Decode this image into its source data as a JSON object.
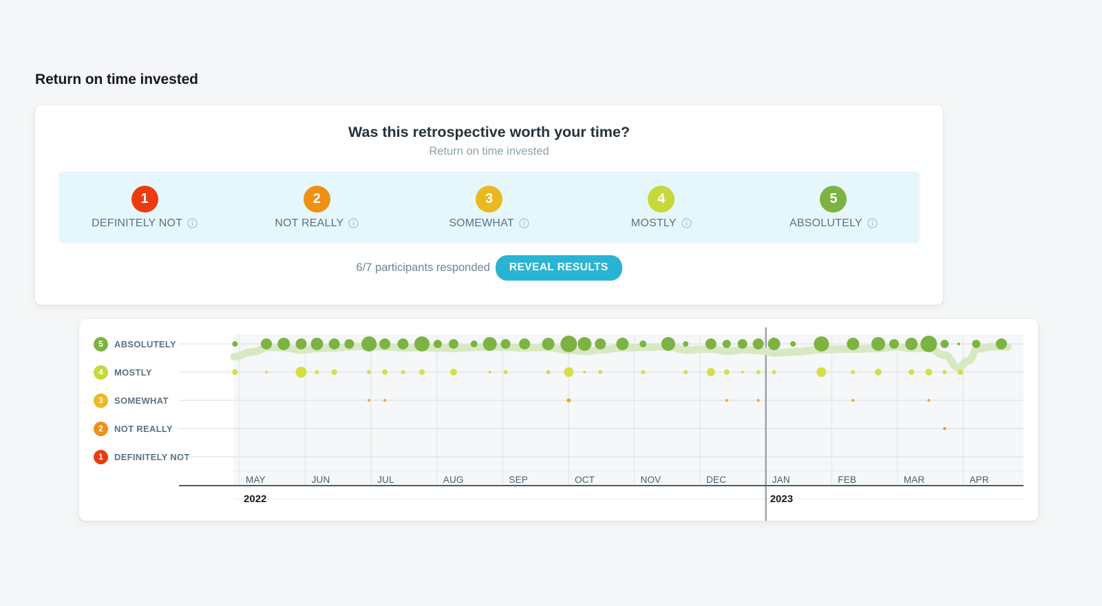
{
  "page": {
    "title": "Return on time invested"
  },
  "poll": {
    "question": "Was this retrospective worth your time?",
    "subtitle": "Return on time invested",
    "participants": "6/7 participants responded",
    "reveal_label": "REVEAL RESULTS",
    "reveal_color": "#2ab4d3",
    "strip_background": "#e5f7fb",
    "options": [
      {
        "value": "1",
        "label": "DEFINITELY NOT",
        "color": "#ed3b11",
        "info_icon": "info-icon"
      },
      {
        "value": "2",
        "label": "NOT REALLY",
        "color": "#ef9014",
        "info_icon": "info-icon"
      },
      {
        "value": "3",
        "label": "SOMEWHAT",
        "color": "#ecb81f",
        "info_icon": "info-icon"
      },
      {
        "value": "4",
        "label": "MOSTLY",
        "color": "#c6d83a",
        "info_icon": "info-icon"
      },
      {
        "value": "5",
        "label": "ABSOLUTELY",
        "color": "#7cb342",
        "info_icon": "info-icon"
      }
    ]
  },
  "chart_data": {
    "type": "scatter",
    "title": "Return on time invested",
    "xlabel": "",
    "ylabel": "",
    "grid": true,
    "legend_position": "left",
    "ylim": [
      1,
      5
    ],
    "y_categories": [
      {
        "value": "5",
        "label": "ABSOLUTELY",
        "color": "#7cb342"
      },
      {
        "value": "4",
        "label": "MOSTLY",
        "color": "#c6d83a"
      },
      {
        "value": "3",
        "label": "SOMEWHAT",
        "color": "#ecb81f"
      },
      {
        "value": "2",
        "label": "NOT REALLY",
        "color": "#ef9014"
      },
      {
        "value": "1",
        "label": "DEFINITELY NOT",
        "color": "#ed3b11"
      }
    ],
    "x_ticks": [
      "MAY",
      "JUN",
      "JUL",
      "AUG",
      "SEP",
      "OCT",
      "NOV",
      "DEC",
      "JAN",
      "FEB",
      "MAR",
      "APR"
    ],
    "year_markers": [
      {
        "label": "2022",
        "tick_index": 0
      },
      {
        "label": "2023",
        "tick_index": 8
      }
    ],
    "year_divider_at_tick": 8,
    "series": [
      {
        "name": "ABSOLUTELY",
        "y": 5,
        "color": "#7cb342",
        "points": [
          {
            "x": 0.06,
            "r": 4
          },
          {
            "x": 2.05,
            "r": 8
          },
          {
            "x": 3.15,
            "r": 9
          },
          {
            "x": 4.25,
            "r": 8
          },
          {
            "x": 5.25,
            "r": 9
          },
          {
            "x": 6.35,
            "r": 8
          },
          {
            "x": 7.3,
            "r": 7
          },
          {
            "x": 8.55,
            "r": 11
          },
          {
            "x": 9.55,
            "r": 8
          },
          {
            "x": 10.7,
            "r": 8
          },
          {
            "x": 11.9,
            "r": 11
          },
          {
            "x": 12.9,
            "r": 6
          },
          {
            "x": 13.9,
            "r": 7
          },
          {
            "x": 15.2,
            "r": 5
          },
          {
            "x": 16.2,
            "r": 10
          },
          {
            "x": 17.2,
            "r": 7
          },
          {
            "x": 18.4,
            "r": 8
          },
          {
            "x": 19.9,
            "r": 9
          },
          {
            "x": 21.2,
            "r": 12
          },
          {
            "x": 22.2,
            "r": 10
          },
          {
            "x": 23.2,
            "r": 8
          },
          {
            "x": 24.6,
            "r": 9
          },
          {
            "x": 25.9,
            "r": 5
          },
          {
            "x": 27.5,
            "r": 10
          },
          {
            "x": 28.6,
            "r": 4
          },
          {
            "x": 30.2,
            "r": 8
          },
          {
            "x": 31.2,
            "r": 6
          },
          {
            "x": 32.2,
            "r": 7
          },
          {
            "x": 33.2,
            "r": 8
          },
          {
            "x": 34.2,
            "r": 9
          },
          {
            "x": 35.4,
            "r": 4
          },
          {
            "x": 37.2,
            "r": 11
          },
          {
            "x": 39.2,
            "r": 9
          },
          {
            "x": 40.8,
            "r": 10
          },
          {
            "x": 41.8,
            "r": 7
          },
          {
            "x": 42.9,
            "r": 9
          },
          {
            "x": 44.0,
            "r": 12
          },
          {
            "x": 45.0,
            "r": 6
          },
          {
            "x": 45.9,
            "r": 2
          },
          {
            "x": 47.0,
            "r": 6
          },
          {
            "x": 48.6,
            "r": 8
          }
        ]
      },
      {
        "name": "MOSTLY",
        "y": 4,
        "color": "#d4df48",
        "points": [
          {
            "x": 0.06,
            "r": 4
          },
          {
            "x": 2.05,
            "r": 2
          },
          {
            "x": 4.25,
            "r": 8
          },
          {
            "x": 5.25,
            "r": 3
          },
          {
            "x": 6.35,
            "r": 4
          },
          {
            "x": 8.55,
            "r": 3
          },
          {
            "x": 9.55,
            "r": 4
          },
          {
            "x": 10.7,
            "r": 3
          },
          {
            "x": 11.9,
            "r": 4
          },
          {
            "x": 13.9,
            "r": 5
          },
          {
            "x": 16.2,
            "r": 2
          },
          {
            "x": 17.2,
            "r": 3
          },
          {
            "x": 19.9,
            "r": 3
          },
          {
            "x": 21.2,
            "r": 7
          },
          {
            "x": 22.2,
            "r": 2
          },
          {
            "x": 23.2,
            "r": 3
          },
          {
            "x": 25.9,
            "r": 3
          },
          {
            "x": 28.6,
            "r": 3
          },
          {
            "x": 30.2,
            "r": 6
          },
          {
            "x": 31.2,
            "r": 4
          },
          {
            "x": 32.2,
            "r": 2
          },
          {
            "x": 33.2,
            "r": 3
          },
          {
            "x": 34.2,
            "r": 3
          },
          {
            "x": 37.2,
            "r": 7
          },
          {
            "x": 39.2,
            "r": 3
          },
          {
            "x": 40.8,
            "r": 5
          },
          {
            "x": 42.9,
            "r": 4
          },
          {
            "x": 44.0,
            "r": 5
          },
          {
            "x": 45.0,
            "r": 3
          },
          {
            "x": 46.0,
            "r": 4
          }
        ]
      },
      {
        "name": "SOMEWHAT",
        "y": 3,
        "color": "#f0a81e",
        "points": [
          {
            "x": 8.55,
            "r": 2
          },
          {
            "x": 9.55,
            "r": 2
          },
          {
            "x": 21.2,
            "r": 3
          },
          {
            "x": 31.2,
            "r": 2
          },
          {
            "x": 33.2,
            "r": 2
          },
          {
            "x": 39.2,
            "r": 2
          },
          {
            "x": 44.0,
            "r": 2
          }
        ]
      },
      {
        "name": "NOT REALLY",
        "y": 2,
        "color": "#ef8a14",
        "points": [
          {
            "x": 45.0,
            "r": 2
          }
        ]
      },
      {
        "name": "DEFINITELY NOT",
        "y": 1,
        "color": "#ed3b11",
        "points": []
      }
    ],
    "trend_line": {
      "color": "#d8e8c2",
      "width": 11,
      "points": [
        [
          0.0,
          4.55
        ],
        [
          1.2,
          4.72
        ],
        [
          2.2,
          4.88
        ],
        [
          3.3,
          4.86
        ],
        [
          4.3,
          4.78
        ],
        [
          5.3,
          4.84
        ],
        [
          6.4,
          4.86
        ],
        [
          7.4,
          4.9
        ],
        [
          8.5,
          4.92
        ],
        [
          9.6,
          4.9
        ],
        [
          10.7,
          4.86
        ],
        [
          11.9,
          4.88
        ],
        [
          12.9,
          4.86
        ],
        [
          14.0,
          4.84
        ],
        [
          15.3,
          4.88
        ],
        [
          16.3,
          4.9
        ],
        [
          17.3,
          4.88
        ],
        [
          18.5,
          4.86
        ],
        [
          19.9,
          4.88
        ],
        [
          21.2,
          4.78
        ],
        [
          22.3,
          4.74
        ],
        [
          23.3,
          4.8
        ],
        [
          24.6,
          4.86
        ],
        [
          25.9,
          4.88
        ],
        [
          27.5,
          4.9
        ],
        [
          28.7,
          4.78
        ],
        [
          30.2,
          4.82
        ],
        [
          31.3,
          4.74
        ],
        [
          32.3,
          4.8
        ],
        [
          33.3,
          4.76
        ],
        [
          34.3,
          4.68
        ],
        [
          35.5,
          4.72
        ],
        [
          37.2,
          4.8
        ],
        [
          39.3,
          4.82
        ],
        [
          40.9,
          4.84
        ],
        [
          41.9,
          4.9
        ],
        [
          42.9,
          4.84
        ],
        [
          44.0,
          4.86
        ],
        [
          45.0,
          4.6
        ],
        [
          45.9,
          4.16
        ],
        [
          46.5,
          4.4
        ],
        [
          47.1,
          4.82
        ],
        [
          48.0,
          4.9
        ],
        [
          49.0,
          4.9
        ]
      ]
    }
  }
}
